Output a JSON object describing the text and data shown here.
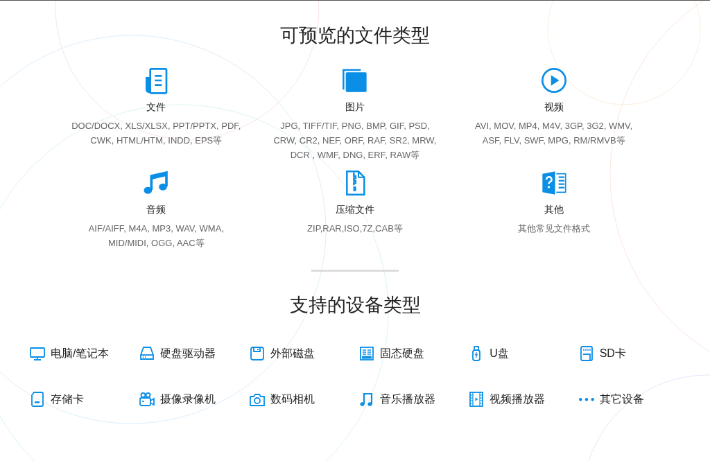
{
  "preview_section": {
    "title": "可预览的文件类型",
    "file_types": [
      {
        "name": "文件",
        "formats": "DOC/DOCX, XLS/XLSX, PPT/PPTX, PDF, CWK, HTML/HTM, INDD, EPS等"
      },
      {
        "name": "图片",
        "formats": "JPG, TIFF/TIF, PNG, BMP, GIF, PSD, CRW, CR2, NEF, ORF, RAF, SR2, MRW, DCR , WMF, DNG, ERF, RAW等"
      },
      {
        "name": "视频",
        "formats": "AVI, MOV, MP4, M4V, 3GP, 3G2, WMV, ASF, FLV, SWF, MPG, RM/RMVB等"
      },
      {
        "name": "音频",
        "formats": "AIF/AIFF, M4A, MP3, WAV, WMA, MID/MIDI, OGG, AAC等"
      },
      {
        "name": "压缩文件",
        "formats": "ZIP,RAR,ISO,7Z,CAB等"
      },
      {
        "name": "其他",
        "formats": "其他常见文件格式"
      }
    ]
  },
  "device_section": {
    "title": "支持的设备类型",
    "devices": [
      {
        "label": "电脑/笔记本"
      },
      {
        "label": "硬盘驱动器"
      },
      {
        "label": "外部磁盘"
      },
      {
        "label": "固态硬盘"
      },
      {
        "label": "U盘"
      },
      {
        "label": "SD卡"
      },
      {
        "label": "存储卡"
      },
      {
        "label": "摄像录像机"
      },
      {
        "label": "数码相机"
      },
      {
        "label": "音乐播放器"
      },
      {
        "label": "视频播放器"
      },
      {
        "label": "其它设备"
      }
    ]
  }
}
